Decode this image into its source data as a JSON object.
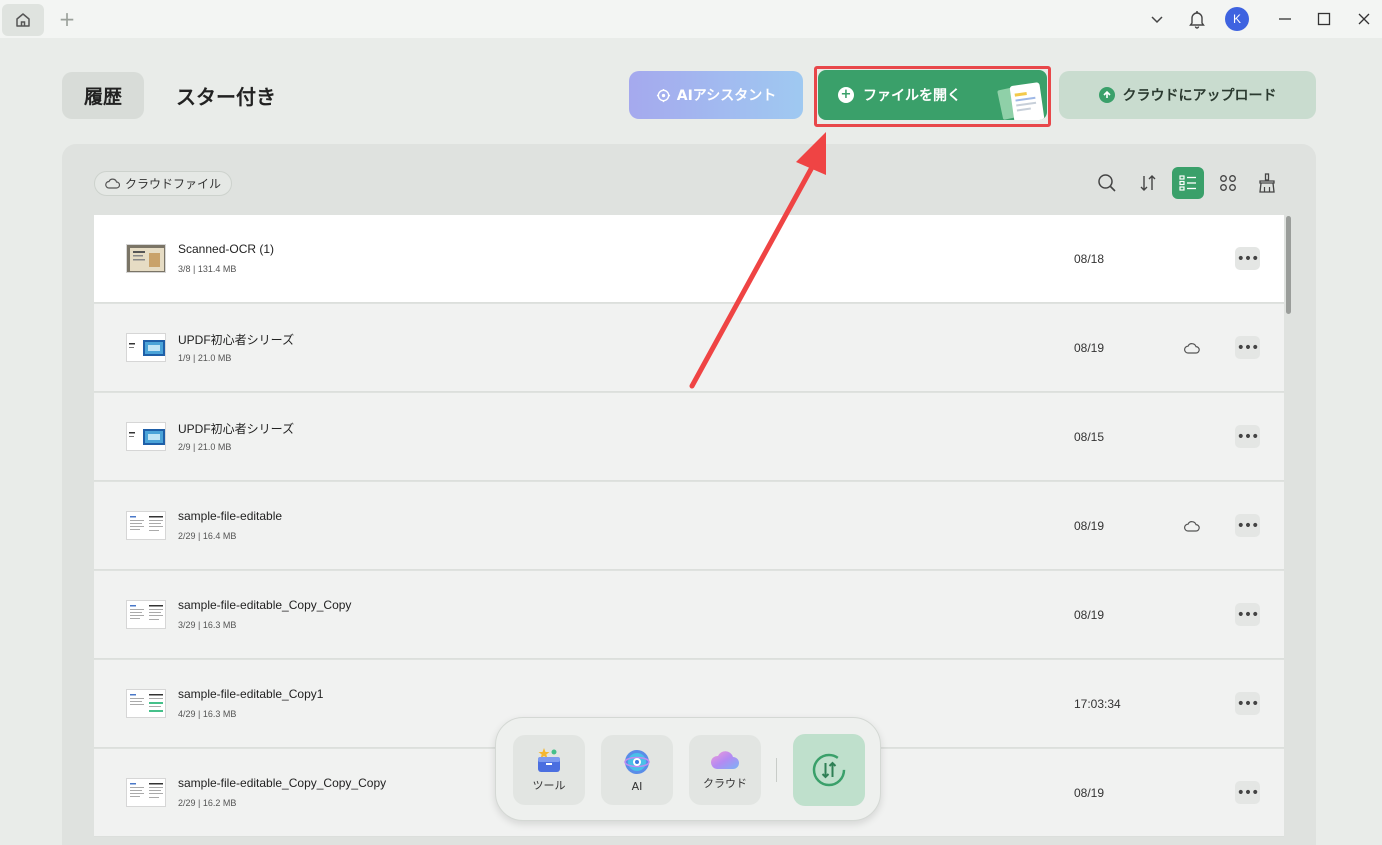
{
  "window": {
    "icons": [
      "home-icon",
      "plus-icon",
      "chevron-down-icon",
      "bell-icon",
      "minimize-icon",
      "maximize-icon",
      "close-icon"
    ],
    "avatar_initial": "K"
  },
  "tabs": {
    "history": "履歴",
    "starred": "スター付き"
  },
  "actions": {
    "ai_assistant": "AIアシスタント",
    "open_file": "ファイルを開く",
    "upload_cloud": "クラウドにアップロード"
  },
  "filter": {
    "cloud_files": "クラウドファイル"
  },
  "colors": {
    "accent_green": "#3aa06a",
    "highlight_red": "#e8474a"
  },
  "files": [
    {
      "name": "Scanned-OCR (1)",
      "meta": "3/8 | 131.4 MB",
      "date": "08/18",
      "cloud": false,
      "thumb": "scan"
    },
    {
      "name": "UPDF初心者シリーズ",
      "meta": "1/9 | 21.0 MB",
      "date": "08/19",
      "cloud": true,
      "thumb": "slide"
    },
    {
      "name": "UPDF初心者シリーズ",
      "meta": "2/9 | 21.0 MB",
      "date": "08/15",
      "cloud": false,
      "thumb": "slide"
    },
    {
      "name": "sample-file-editable",
      "meta": "2/29 | 16.4 MB",
      "date": "08/19",
      "cloud": true,
      "thumb": "doc"
    },
    {
      "name": "sample-file-editable_Copy_Copy",
      "meta": "3/29 | 16.3 MB",
      "date": "08/19",
      "cloud": false,
      "thumb": "doc"
    },
    {
      "name": "sample-file-editable_Copy1",
      "meta": "4/29 | 16.3 MB",
      "date": "17:03:34",
      "cloud": false,
      "thumb": "doc2"
    },
    {
      "name": "sample-file-editable_Copy_Copy_Copy",
      "meta": "2/29 | 16.2 MB",
      "date": "08/19",
      "cloud": false,
      "thumb": "doc"
    }
  ],
  "dock": {
    "tools": "ツール",
    "ai": "AI",
    "cloud": "クラウド"
  }
}
